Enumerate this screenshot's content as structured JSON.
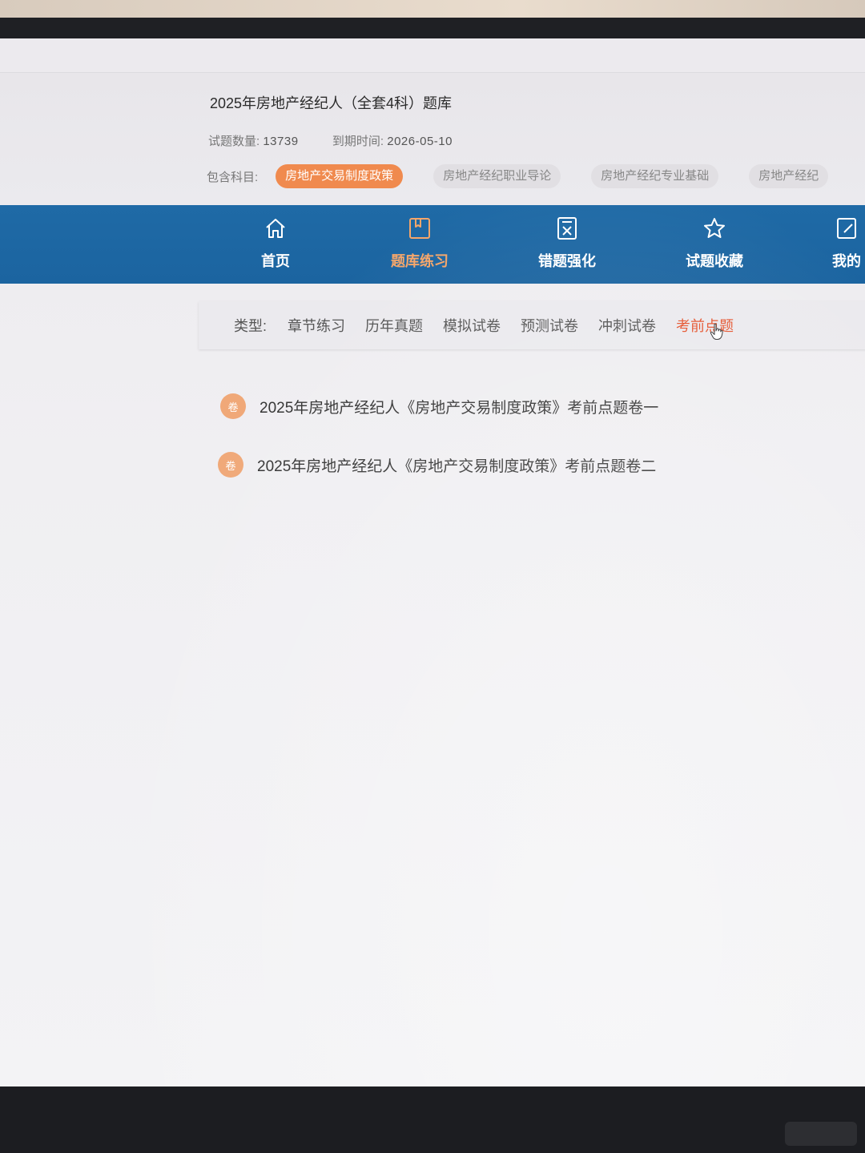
{
  "header": {
    "title": "2025年房地产经纪人（全套4科）题库",
    "question_count_label": "试题数量:",
    "question_count": "13739",
    "expiry_label": "到期时间:",
    "expiry_date": "2026-05-10",
    "subjects_label": "包含科目:",
    "subjects": [
      {
        "label": "房地产交易制度政策",
        "active": true
      },
      {
        "label": "房地产经纪职业导论",
        "active": false
      },
      {
        "label": "房地产经纪专业基础",
        "active": false
      },
      {
        "label": "房地产经纪",
        "active": false
      }
    ]
  },
  "nav": {
    "items": [
      {
        "label": "首页",
        "icon": "home-icon",
        "active": false
      },
      {
        "label": "题库练习",
        "icon": "book-icon",
        "active": true
      },
      {
        "label": "错题强化",
        "icon": "wrong-question-icon",
        "active": false
      },
      {
        "label": "试题收藏",
        "icon": "star-icon",
        "active": false
      },
      {
        "label": "我的",
        "icon": "edit-icon",
        "active": false
      }
    ],
    "accent_color": "#1c65a1",
    "active_color": "#f5a66a"
  },
  "types": {
    "label": "类型:",
    "items": [
      {
        "label": "章节练习",
        "active": false
      },
      {
        "label": "历年真题",
        "active": false
      },
      {
        "label": "模拟试卷",
        "active": false
      },
      {
        "label": "预测试卷",
        "active": false
      },
      {
        "label": "冲刺试卷",
        "active": false
      },
      {
        "label": "考前点题",
        "active": true
      }
    ],
    "active_color": "#e5532d"
  },
  "papers": [
    {
      "badge": "卷",
      "title": "2025年房地产经纪人《房地产交易制度政策》考前点题卷一"
    },
    {
      "badge": "卷",
      "title": "2025年房地产经纪人《房地产交易制度政策》考前点题卷二"
    }
  ]
}
